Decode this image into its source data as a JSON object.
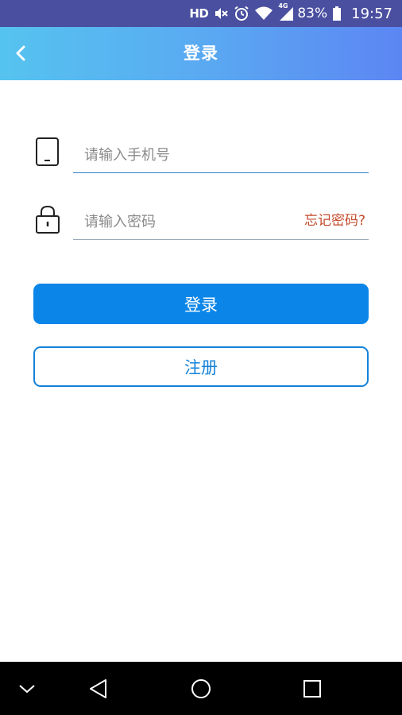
{
  "status_bar": {
    "hd": "HD",
    "network": "4G",
    "battery": "83%",
    "time": "19:57"
  },
  "header": {
    "title": "登录",
    "back_icon": "chevron-left-icon"
  },
  "form": {
    "phone_placeholder": "请输入手机号",
    "phone_value": "",
    "password_placeholder": "请输入密码",
    "password_value": "",
    "forgot_password": "忘记密码?"
  },
  "buttons": {
    "login": "登录",
    "register": "注册"
  },
  "colors": {
    "status_bar": "#4a4fa0",
    "header_start": "#55c3ef",
    "header_end": "#5c86f3",
    "primary": "#0b86e8",
    "forgot_link": "#c44a2c"
  },
  "nav_icons": [
    "chevron-down-icon",
    "back-triangle-icon",
    "home-circle-icon",
    "recents-square-icon"
  ]
}
